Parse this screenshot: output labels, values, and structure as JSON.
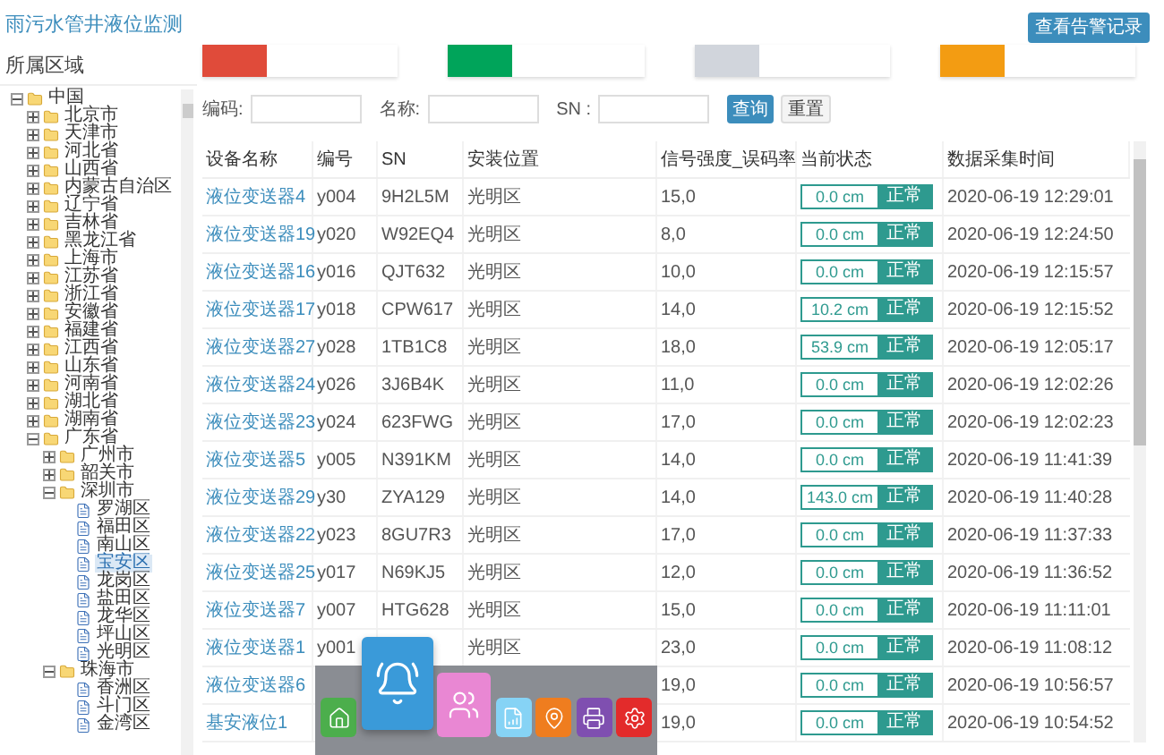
{
  "app_title": "雨污水管井液位监测",
  "sidebar": {
    "title": "所属区域",
    "tree": [
      {
        "label": "中国",
        "kind": "folder",
        "expanded": true,
        "selected": false,
        "children": [
          {
            "label": "北京市",
            "kind": "folder",
            "expanded": false,
            "selected": false
          },
          {
            "label": "天津市",
            "kind": "folder",
            "expanded": false,
            "selected": false
          },
          {
            "label": "河北省",
            "kind": "folder",
            "expanded": false,
            "selected": false
          },
          {
            "label": "山西省",
            "kind": "folder",
            "expanded": false,
            "selected": false
          },
          {
            "label": "内蒙古自治区",
            "kind": "folder",
            "expanded": false,
            "selected": false
          },
          {
            "label": "辽宁省",
            "kind": "folder",
            "expanded": false,
            "selected": false
          },
          {
            "label": "吉林省",
            "kind": "folder",
            "expanded": false,
            "selected": false
          },
          {
            "label": "黑龙江省",
            "kind": "folder",
            "expanded": false,
            "selected": false
          },
          {
            "label": "上海市",
            "kind": "folder",
            "expanded": false,
            "selected": false
          },
          {
            "label": "江苏省",
            "kind": "folder",
            "expanded": false,
            "selected": false
          },
          {
            "label": "浙江省",
            "kind": "folder",
            "expanded": false,
            "selected": false
          },
          {
            "label": "安徽省",
            "kind": "folder",
            "expanded": false,
            "selected": false
          },
          {
            "label": "福建省",
            "kind": "folder",
            "expanded": false,
            "selected": false
          },
          {
            "label": "江西省",
            "kind": "folder",
            "expanded": false,
            "selected": false
          },
          {
            "label": "山东省",
            "kind": "folder",
            "expanded": false,
            "selected": false
          },
          {
            "label": "河南省",
            "kind": "folder",
            "expanded": false,
            "selected": false
          },
          {
            "label": "湖北省",
            "kind": "folder",
            "expanded": false,
            "selected": false
          },
          {
            "label": "湖南省",
            "kind": "folder",
            "expanded": false,
            "selected": false
          },
          {
            "label": "广东省",
            "kind": "folder",
            "expanded": true,
            "selected": false,
            "children": [
              {
                "label": "广州市",
                "kind": "folder",
                "expanded": false,
                "selected": false
              },
              {
                "label": "韶关市",
                "kind": "folder",
                "expanded": false,
                "selected": false
              },
              {
                "label": "深圳市",
                "kind": "folder",
                "expanded": true,
                "selected": false,
                "children": [
                  {
                    "label": "罗湖区",
                    "kind": "leaf",
                    "selected": false
                  },
                  {
                    "label": "福田区",
                    "kind": "leaf",
                    "selected": false
                  },
                  {
                    "label": "南山区",
                    "kind": "leaf",
                    "selected": false
                  },
                  {
                    "label": "宝安区",
                    "kind": "leaf",
                    "selected": true
                  },
                  {
                    "label": "龙岗区",
                    "kind": "leaf",
                    "selected": false
                  },
                  {
                    "label": "盐田区",
                    "kind": "leaf",
                    "selected": false
                  },
                  {
                    "label": "龙华区",
                    "kind": "leaf",
                    "selected": false
                  },
                  {
                    "label": "坪山区",
                    "kind": "leaf",
                    "selected": false
                  },
                  {
                    "label": "光明区",
                    "kind": "leaf",
                    "selected": false
                  }
                ]
              },
              {
                "label": "珠海市",
                "kind": "folder",
                "expanded": true,
                "selected": false,
                "children": [
                  {
                    "label": "香洲区",
                    "kind": "leaf",
                    "selected": false
                  },
                  {
                    "label": "斗门区",
                    "kind": "leaf",
                    "selected": false
                  },
                  {
                    "label": "金湾区",
                    "kind": "leaf",
                    "selected": false
                  }
                ]
              }
            ]
          }
        ]
      }
    ]
  },
  "alarm_button": "查看告警记录",
  "stat_cards": [
    {
      "color": "#e04b3a"
    },
    {
      "color": "#00a45a"
    },
    {
      "color": "#d1d5dc"
    },
    {
      "color": "#f39c12"
    }
  ],
  "search": {
    "fields": [
      {
        "label": "编码:"
      },
      {
        "label": "名称:"
      },
      {
        "label": "SN :"
      }
    ],
    "buttons": [
      {
        "label": "查询",
        "kind": "primary"
      },
      {
        "label": "重置",
        "kind": "default"
      }
    ]
  },
  "table": {
    "columns": [
      "设备名称",
      "编号",
      "SN",
      "安装位置",
      "信号强度_误码率",
      "当前状态",
      "数据采集时间"
    ],
    "rows": [
      {
        "name": "液位变送器4",
        "code": "y004",
        "sn": "9H2L5M",
        "location": "光明区",
        "signal": "15,0",
        "level_text": "0.0 cm",
        "status": "正常",
        "time": "2020-06-19 12:29:01"
      },
      {
        "name": "液位变送器19",
        "code": "y020",
        "sn": "W92EQ4",
        "location": "光明区",
        "signal": "8,0",
        "level_text": "0.0 cm",
        "status": "正常",
        "time": "2020-06-19 12:24:50"
      },
      {
        "name": "液位变送器16",
        "code": "y016",
        "sn": "QJT632",
        "location": "光明区",
        "signal": "10,0",
        "level_text": "0.0 cm",
        "status": "正常",
        "time": "2020-06-19 12:15:57"
      },
      {
        "name": "液位变送器17",
        "code": "y018",
        "sn": "CPW617",
        "location": "光明区",
        "signal": "14,0",
        "level_text": "10.2 cm",
        "status": "正常",
        "time": "2020-06-19 12:15:52"
      },
      {
        "name": "液位变送器27",
        "code": "y028",
        "sn": "1TB1C8",
        "location": "光明区",
        "signal": "18,0",
        "level_text": "53.9 cm",
        "status": "正常",
        "time": "2020-06-19 12:05:17"
      },
      {
        "name": "液位变送器24",
        "code": "y026",
        "sn": "3J6B4K",
        "location": "光明区",
        "signal": "11,0",
        "level_text": "0.0 cm",
        "status": "正常",
        "time": "2020-06-19 12:02:26"
      },
      {
        "name": "液位变送器23",
        "code": "y024",
        "sn": "623FWG",
        "location": "光明区",
        "signal": "17,0",
        "level_text": "0.0 cm",
        "status": "正常",
        "time": "2020-06-19 12:02:23"
      },
      {
        "name": "液位变送器5",
        "code": "y005",
        "sn": "N391KM",
        "location": "光明区",
        "signal": "14,0",
        "level_text": "0.0 cm",
        "status": "正常",
        "time": "2020-06-19 11:41:39"
      },
      {
        "name": "液位变送器29",
        "code": "y30",
        "sn": "ZYA129",
        "location": "光明区",
        "signal": "14,0",
        "level_text": "143.0 cm",
        "status": "正常",
        "time": "2020-06-19 11:40:28"
      },
      {
        "name": "液位变送器22",
        "code": "y023",
        "sn": "8GU7R3",
        "location": "光明区",
        "signal": "17,0",
        "level_text": "0.0 cm",
        "status": "正常",
        "time": "2020-06-19 11:37:33"
      },
      {
        "name": "液位变送器25",
        "code": "y017",
        "sn": "N69KJ5",
        "location": "光明区",
        "signal": "12,0",
        "level_text": "0.0 cm",
        "status": "正常",
        "time": "2020-06-19 11:36:52"
      },
      {
        "name": "液位变送器7",
        "code": "y007",
        "sn": "HTG628",
        "location": "光明区",
        "signal": "15,0",
        "level_text": "0.0 cm",
        "status": "正常",
        "time": "2020-06-19 11:11:01"
      },
      {
        "name": "液位变送器1",
        "code": "y001",
        "location": "光明区",
        "signal": "23,0",
        "level_text": "0.0 cm",
        "status": "正常",
        "time": "2020-06-19 11:08:12"
      },
      {
        "name": "液位变送器6",
        "signal": "19,0",
        "level_text": "0.0 cm",
        "status": "正常",
        "time": "2020-06-19 10:56:57"
      },
      {
        "name": "基安液位1",
        "signal": "19,0",
        "level_text": "0.0 cm",
        "status": "正常",
        "time": "2020-06-19 10:54:52"
      }
    ]
  },
  "dock": [
    {
      "kind": "home"
    },
    {
      "kind": "bell",
      "selected": true
    },
    {
      "kind": "users"
    },
    {
      "kind": "chart"
    },
    {
      "kind": "map"
    },
    {
      "kind": "printer"
    },
    {
      "kind": "settings"
    }
  ]
}
